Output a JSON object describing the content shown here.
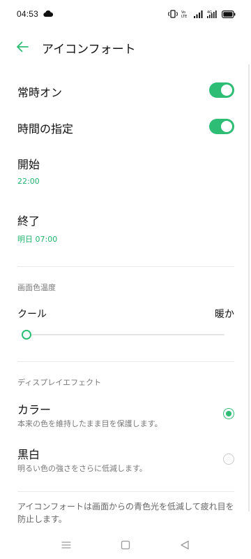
{
  "status_bar": {
    "time": "04:53",
    "icons": [
      "cloud-icon",
      "vibrate-icon",
      "volte-icon",
      "signal-icon",
      "4g-signal-icon",
      "battery-icon"
    ]
  },
  "header": {
    "title": "アイコンフォート",
    "back_icon": "back-arrow-icon"
  },
  "settings": {
    "always_on": {
      "label": "常時オン",
      "enabled": true
    },
    "schedule": {
      "label": "時間の指定",
      "enabled": true
    },
    "start": {
      "label": "開始",
      "value": "22:00"
    },
    "end": {
      "label": "終了",
      "value": "明日 07:00"
    }
  },
  "color_temperature": {
    "header": "画面色温度",
    "cool_label": "クール",
    "warm_label": "暖か",
    "level": 0
  },
  "display_effect": {
    "header": "ディスプレイエフェクト",
    "options": [
      {
        "label": "カラー",
        "description": "本来の色を維持したまま目を保護します。",
        "selected": true
      },
      {
        "label": "黒白",
        "description": "明るい色の強さをさらに低減します。",
        "selected": false
      }
    ]
  },
  "footer": {
    "note": "アイコンフォートは画面からの青色光を低減して疲れ目を防止します。"
  },
  "nav_bar": {
    "buttons": [
      "menu-icon",
      "home-icon",
      "back-icon"
    ]
  },
  "colors": {
    "accent": "#2ebd74",
    "accent_text": "#1fb36c"
  }
}
